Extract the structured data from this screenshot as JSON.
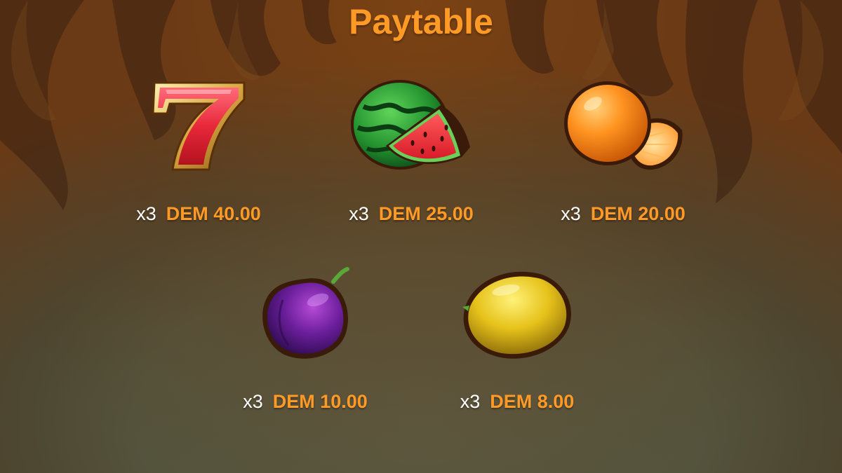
{
  "title": "Paytable",
  "colors": {
    "accent": "#ff9a26",
    "text": "#ffffff"
  },
  "symbols": [
    {
      "icon": "seven-icon",
      "multiplier": "x3",
      "payout": "DEM 40.00"
    },
    {
      "icon": "watermelon-icon",
      "multiplier": "x3",
      "payout": "DEM 25.00"
    },
    {
      "icon": "orange-icon",
      "multiplier": "x3",
      "payout": "DEM 20.00"
    },
    {
      "icon": "plum-icon",
      "multiplier": "x3",
      "payout": "DEM 10.00"
    },
    {
      "icon": "lemon-icon",
      "multiplier": "x3",
      "payout": "DEM 8.00"
    }
  ]
}
